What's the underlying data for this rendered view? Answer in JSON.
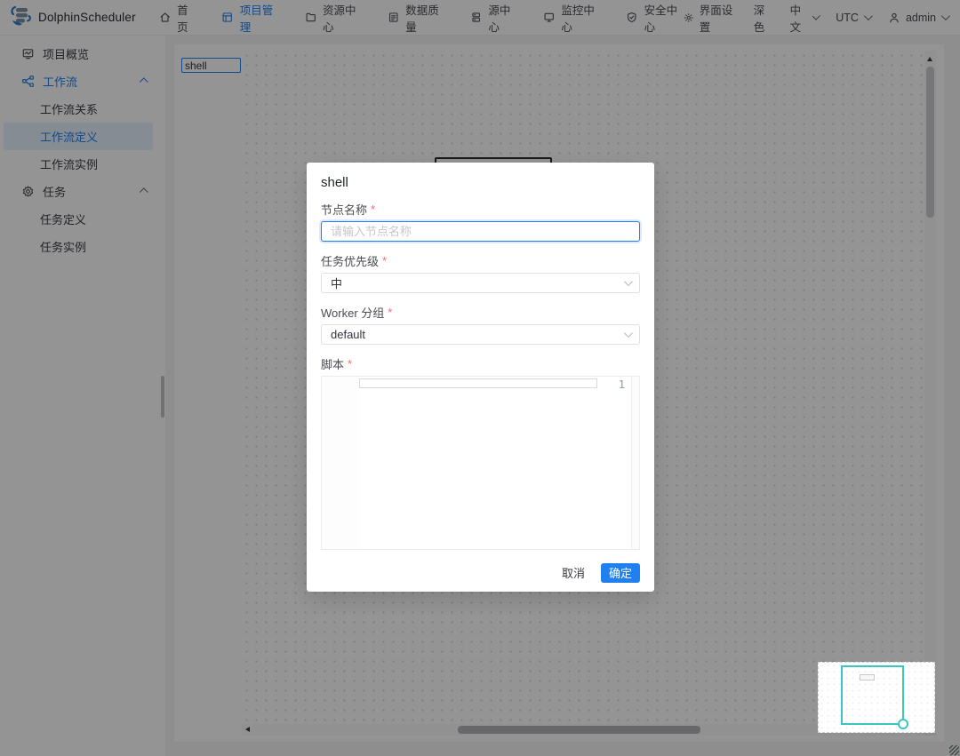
{
  "nav": {
    "brand": "DolphinScheduler",
    "items": [
      {
        "label": "首页"
      },
      {
        "label": "项目管理"
      },
      {
        "label": "资源中心"
      },
      {
        "label": "数据质量"
      },
      {
        "label": "源中心"
      },
      {
        "label": "监控中心"
      },
      {
        "label": "安全中心"
      }
    ],
    "ui_settings": "界面设置",
    "theme_toggle": "深色",
    "language": "中文",
    "timezone": "UTC",
    "username": "admin"
  },
  "sidebar": {
    "items": [
      {
        "label": "项目概览"
      },
      {
        "label": "工作流"
      },
      {
        "label": "工作流关系"
      },
      {
        "label": "工作流定义"
      },
      {
        "label": "工作流实例"
      },
      {
        "label": "任务"
      },
      {
        "label": "任务定义"
      },
      {
        "label": "任务实例"
      }
    ]
  },
  "canvas": {
    "workflow_name": "shell"
  },
  "modal": {
    "title": "shell",
    "required_mark": "*",
    "node_name": {
      "label": "节点名称",
      "placeholder": "请输入节点名称",
      "value": ""
    },
    "priority": {
      "label": "任务优先级",
      "value": "中"
    },
    "worker_group": {
      "label": "Worker 分组",
      "value": "default"
    },
    "script": {
      "label": "脚本",
      "line_number": "1"
    },
    "cancel_label": "取消",
    "confirm_label": "确定"
  },
  "colors": {
    "primary": "#2080F0",
    "minimap_accent": "#3AC5C0",
    "required": "#F56C6C"
  }
}
